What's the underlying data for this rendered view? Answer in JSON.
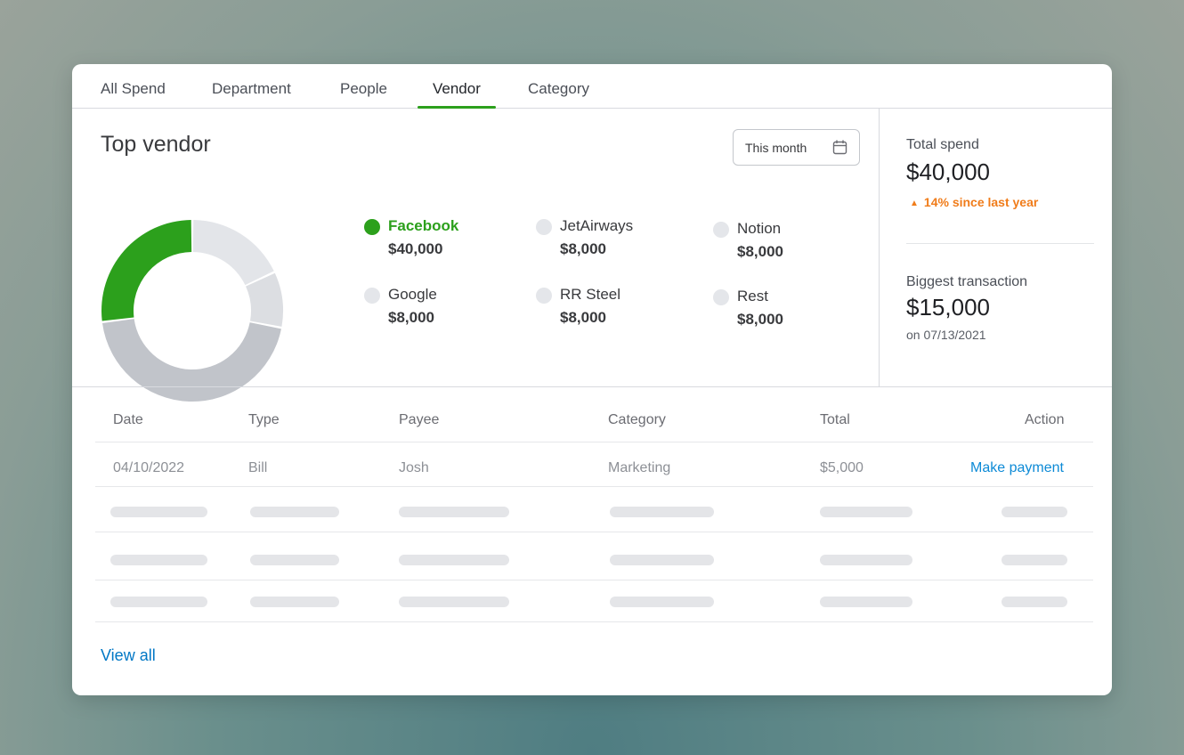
{
  "tabs": [
    {
      "label": "All Spend"
    },
    {
      "label": "Department"
    },
    {
      "label": "People"
    },
    {
      "label": "Vendor",
      "active": true
    },
    {
      "label": "Category"
    }
  ],
  "top_vendor": {
    "title": "Top vendor",
    "date_filter": "This month",
    "legend": [
      {
        "name": "Facebook",
        "value": "$40,000",
        "color": "#2ca01c",
        "active": true
      },
      {
        "name": "JetAirways",
        "value": "$8,000",
        "color": "#e4e6ea"
      },
      {
        "name": "Notion",
        "value": "$8,000",
        "color": "#e4e6ea"
      },
      {
        "name": "Google",
        "value": "$8,000",
        "color": "#e4e6ea"
      },
      {
        "name": "RR Steel",
        "value": "$8,000",
        "color": "#e4e6ea"
      },
      {
        "name": "Rest",
        "value": "$8,000",
        "color": "#e4e6ea"
      }
    ]
  },
  "donut_segments": [
    {
      "fraction": 0.27,
      "color": "#2ca01c"
    },
    {
      "fraction": 0.18,
      "color": "#e3e5e9"
    },
    {
      "fraction": 0.1,
      "color": "#dcdee2"
    },
    {
      "fraction": 0.45,
      "color": "#c1c4ca"
    }
  ],
  "stats": {
    "total_spend_label": "Total spend",
    "total_spend_value": "$40,000",
    "total_spend_change": "14% since last year",
    "biggest_label": "Biggest transaction",
    "biggest_value": "$15,000",
    "biggest_date": "on 07/13/2021"
  },
  "table": {
    "headers": {
      "date": "Date",
      "type": "Type",
      "payee": "Payee",
      "category": "Category",
      "total": "Total",
      "action": "Action"
    },
    "row": {
      "date": "04/10/2022",
      "type": "Bill",
      "payee": "Josh",
      "category": "Marketing",
      "total": "$5,000",
      "action": "Make payment"
    },
    "view_all": "View all"
  },
  "colors": {
    "accent": "#2ca01c",
    "link": "#0077c5",
    "change": "#f07c1a"
  }
}
